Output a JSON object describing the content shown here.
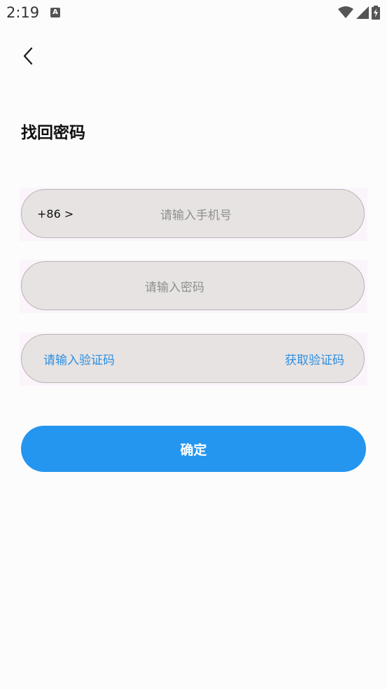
{
  "status_bar": {
    "time": "2:19",
    "notification_glyph": "A"
  },
  "header": {
    "back_icon": "chevron-left-icon",
    "title": "找回密码"
  },
  "form": {
    "phone": {
      "country_code": "+86 >",
      "placeholder": "请输入手机号"
    },
    "password": {
      "placeholder": "请输入密码"
    },
    "code": {
      "placeholder": "请输入验证码",
      "get_code_label": "获取验证码"
    },
    "submit_label": "确定"
  },
  "colors": {
    "accent": "#2496f0",
    "link": "#2e8fe0",
    "field_bg": "#e7e3e3"
  }
}
